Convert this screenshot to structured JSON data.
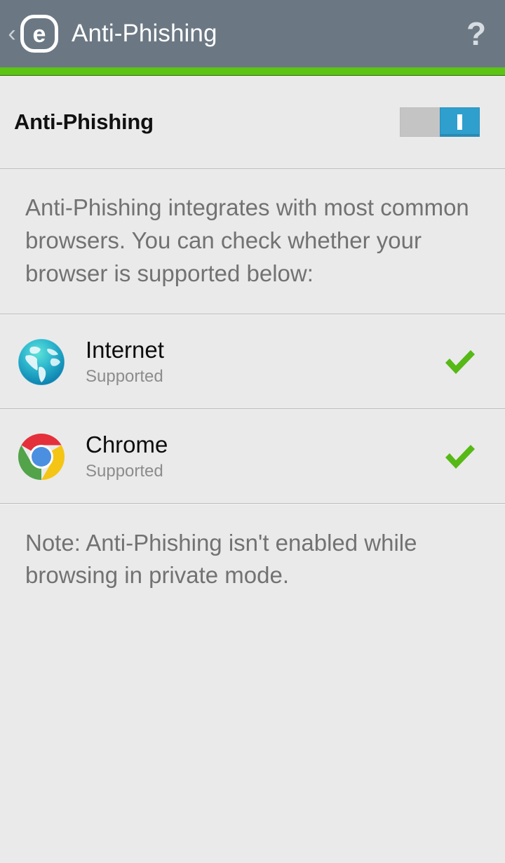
{
  "header": {
    "back_label": "‹",
    "logo_letter": "e",
    "logo_name": "eset-logo",
    "title": "Anti-Phishing",
    "help_label": "?"
  },
  "accent": {
    "color": "#5cc414"
  },
  "master": {
    "label": "Anti-Phishing",
    "toggle_state": "on",
    "toggle_mark": "I",
    "toggle_on_color": "#2f9fcd",
    "toggle_track_color": "#c4c4c4"
  },
  "description": {
    "text": "Anti-Phishing integrates with most common browsers. You can check whether your browser is supported below:"
  },
  "browsers": [
    {
      "name": "Internet",
      "status": "Supported",
      "icon": "globe-icon",
      "check": "check-icon",
      "check_color": "#56b916"
    },
    {
      "name": "Chrome",
      "status": "Supported",
      "icon": "chrome-icon",
      "check": "check-icon",
      "check_color": "#56b916"
    }
  ],
  "note": {
    "text": "Note: Anti-Phishing isn't enabled while browsing in private mode."
  },
  "colors": {
    "header_bg": "#6b7884",
    "page_bg": "#eaeaea",
    "divider": "#bcbcbc",
    "body_text": "#727272",
    "title_text": "#111111"
  }
}
